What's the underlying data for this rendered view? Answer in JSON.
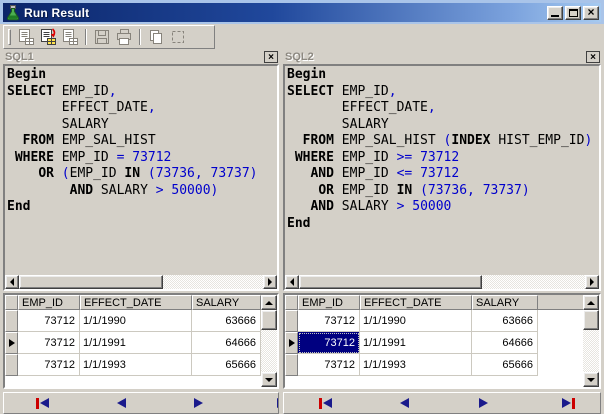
{
  "window": {
    "title": "Run Result",
    "icon": "flask-icon",
    "close_glyph": "×",
    "controls": [
      "minimize",
      "maximize",
      "close"
    ]
  },
  "colors": {
    "chrome": "#d4d0c8",
    "title_gradient_start": "#0b2569",
    "title_gradient_end": "#a6caf0",
    "sql_literal": "#0000cc",
    "selection_bg": "#000080",
    "selection_fg": "#ffffff"
  },
  "toolbar": {
    "buttons": [
      {
        "name": "run-review-icon",
        "enabled": false
      },
      {
        "name": "run-selected-icon",
        "enabled": true
      },
      {
        "name": "run-all-icon",
        "enabled": false
      },
      {
        "name": "save-icon",
        "enabled": false
      },
      {
        "name": "print-icon",
        "enabled": false
      },
      {
        "name": "copy-icon",
        "enabled": false
      },
      {
        "name": "fit-icon",
        "enabled": false
      }
    ]
  },
  "panels": [
    {
      "title": "SQL1",
      "code": [
        [
          {
            "k": "kw",
            "s": "Begin"
          }
        ],
        [
          {
            "k": "kw",
            "s": "SELECT"
          },
          {
            "k": "id",
            "s": " EMP_ID"
          },
          {
            "k": "lit",
            "s": ","
          }
        ],
        [
          {
            "k": "id",
            "s": "       EFFECT_DATE"
          },
          {
            "k": "lit",
            "s": ","
          }
        ],
        [
          {
            "k": "id",
            "s": "       SALARY"
          }
        ],
        [
          {
            "k": "id",
            "s": "  "
          },
          {
            "k": "kw",
            "s": "FROM"
          },
          {
            "k": "id",
            "s": " EMP_SAL_HIST"
          }
        ],
        [
          {
            "k": "id",
            "s": " "
          },
          {
            "k": "kw",
            "s": "WHERE"
          },
          {
            "k": "id",
            "s": " EMP_ID "
          },
          {
            "k": "lit",
            "s": "= 73712"
          }
        ],
        [
          {
            "k": "id",
            "s": "    "
          },
          {
            "k": "kw",
            "s": "OR"
          },
          {
            "k": "lit",
            "s": " ("
          },
          {
            "k": "id",
            "s": "EMP_ID "
          },
          {
            "k": "kw",
            "s": "IN"
          },
          {
            "k": "lit",
            "s": " (73736, 73737)"
          }
        ],
        [
          {
            "k": "id",
            "s": "        "
          },
          {
            "k": "kw",
            "s": "AND"
          },
          {
            "k": "id",
            "s": " SALARY "
          },
          {
            "k": "lit",
            "s": "> 50000)"
          }
        ],
        [
          {
            "k": "kw",
            "s": "End"
          }
        ]
      ]
    },
    {
      "title": "SQL2",
      "code": [
        [
          {
            "k": "kw",
            "s": "Begin"
          }
        ],
        [
          {
            "k": "kw",
            "s": "SELECT"
          },
          {
            "k": "id",
            "s": " EMP_ID"
          },
          {
            "k": "lit",
            "s": ","
          }
        ],
        [
          {
            "k": "id",
            "s": "       EFFECT_DATE"
          },
          {
            "k": "lit",
            "s": ","
          }
        ],
        [
          {
            "k": "id",
            "s": "       SALARY"
          }
        ],
        [
          {
            "k": "id",
            "s": "  "
          },
          {
            "k": "kw",
            "s": "FROM"
          },
          {
            "k": "id",
            "s": " EMP_SAL_HIST "
          },
          {
            "k": "lit",
            "s": "("
          },
          {
            "k": "kw",
            "s": "INDEX"
          },
          {
            "k": "id",
            "s": " HIST_EMP_ID"
          },
          {
            "k": "lit",
            "s": ")"
          }
        ],
        [
          {
            "k": "id",
            "s": " "
          },
          {
            "k": "kw",
            "s": "WHERE"
          },
          {
            "k": "id",
            "s": " EMP_ID "
          },
          {
            "k": "lit",
            "s": ">= 73712"
          }
        ],
        [
          {
            "k": "id",
            "s": "   "
          },
          {
            "k": "kw",
            "s": "AND"
          },
          {
            "k": "id",
            "s": " EMP_ID "
          },
          {
            "k": "lit",
            "s": "<= 73712"
          }
        ],
        [
          {
            "k": "id",
            "s": "    "
          },
          {
            "k": "kw",
            "s": "OR"
          },
          {
            "k": "id",
            "s": " EMP_ID "
          },
          {
            "k": "kw",
            "s": "IN"
          },
          {
            "k": "lit",
            "s": " (73736, 73737)"
          }
        ],
        [
          {
            "k": "id",
            "s": "   "
          },
          {
            "k": "kw",
            "s": "AND"
          },
          {
            "k": "id",
            "s": " SALARY "
          },
          {
            "k": "lit",
            "s": "> 50000"
          }
        ],
        [
          {
            "k": "kw",
            "s": "End"
          }
        ]
      ]
    }
  ],
  "grids": [
    {
      "columns": [
        "EMP_ID",
        "EFFECT_DATE",
        "SALARY"
      ],
      "rows": [
        [
          "73712",
          "1/1/1990",
          "63666"
        ],
        [
          "73712",
          "1/1/1991",
          "64666"
        ],
        [
          "73712",
          "1/1/1993",
          "65666"
        ]
      ],
      "current_row_index": 1,
      "selected_cell": null
    },
    {
      "columns": [
        "EMP_ID",
        "EFFECT_DATE",
        "SALARY"
      ],
      "rows": [
        [
          "73712",
          "1/1/1990",
          "63666"
        ],
        [
          "73712",
          "1/1/1991",
          "64666"
        ],
        [
          "73712",
          "1/1/1993",
          "65666"
        ]
      ],
      "current_row_index": 1,
      "selected_cell": {
        "row": 1,
        "col": 0
      }
    }
  ],
  "navigators": [
    {
      "buttons": [
        "first",
        "prior",
        "next",
        "last"
      ]
    },
    {
      "buttons": [
        "first",
        "prior",
        "next",
        "last"
      ]
    }
  ]
}
